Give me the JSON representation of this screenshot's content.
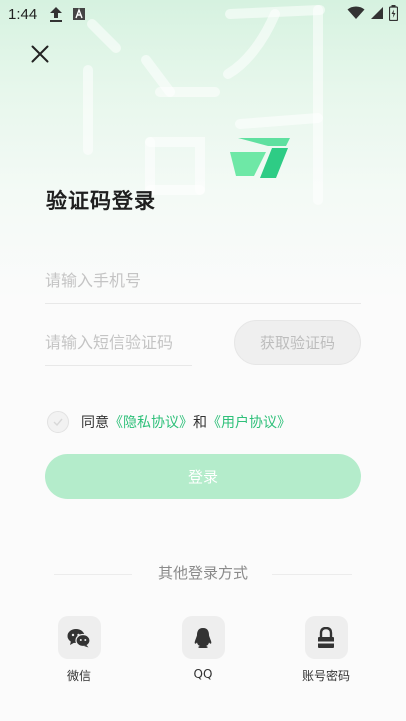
{
  "status_bar": {
    "time": "1:44",
    "icons": [
      "upload-icon",
      "text-notification-icon",
      "wifi-icon",
      "signal-icon",
      "battery-icon"
    ]
  },
  "header": {
    "close_icon": "close-icon",
    "title": "验证码登录"
  },
  "form": {
    "phone": {
      "placeholder": "请输入手机号",
      "value": ""
    },
    "code": {
      "placeholder": "请输入短信验证码",
      "value": ""
    },
    "get_code_label": "获取验证码"
  },
  "agreement": {
    "prefix": "同意",
    "privacy_link": "《隐私协议》",
    "conjunction": "和",
    "user_link": "《用户协议》",
    "checked": false
  },
  "login_button": "登录",
  "other_login": {
    "label": "其他登录方式",
    "methods": [
      {
        "label": "微信",
        "icon": "wechat-icon"
      },
      {
        "label": "QQ",
        "icon": "qq-icon"
      },
      {
        "label": "账号密码",
        "icon": "lock-icon"
      }
    ]
  },
  "colors": {
    "accent": "#2fc07a",
    "login_button_bg": "#b4eccb",
    "header_gradient": "#d6f2e0"
  }
}
